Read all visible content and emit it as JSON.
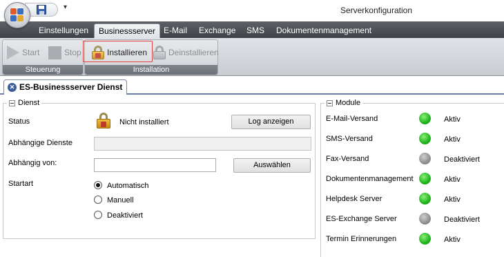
{
  "window": {
    "title": "Serverkonfiguration"
  },
  "ribbon": {
    "tabs": [
      "Einstellungen",
      "Businessserver",
      "E-Mail",
      "Exchange",
      "SMS",
      "Dokumentenmanagement"
    ],
    "active_tab": "Businessserver",
    "groups": [
      {
        "label": "Steuerung",
        "buttons": [
          {
            "label": "Start",
            "icon": "play-icon",
            "enabled": false
          },
          {
            "label": "Stop",
            "icon": "stop-icon",
            "enabled": false
          }
        ]
      },
      {
        "label": "Installation",
        "buttons": [
          {
            "label": "Installieren",
            "icon": "lock-icon",
            "enabled": true
          },
          {
            "label": "Deinstallieren",
            "icon": "lock-icon",
            "enabled": false
          }
        ]
      }
    ]
  },
  "doc_tab": {
    "label": "ES-Businessserver Dienst",
    "close_icon": "close-icon"
  },
  "dienst": {
    "legend": "Dienst",
    "status_label": "Status",
    "status_value": "Nicht installiert",
    "log_button": "Log anzeigen",
    "abhaengige_dienste_label": "Abhängige Dienste",
    "abhaengige_dienste_value": "",
    "abhaengig_von_label": "Abhängig von:",
    "abhaengig_von_value": "",
    "auswaehlen_button": "Auswählen",
    "startart_label": "Startart",
    "startart_options": [
      {
        "label": "Automatisch",
        "checked": true
      },
      {
        "label": "Manuell",
        "checked": false
      },
      {
        "label": "Deaktiviert",
        "checked": false
      }
    ]
  },
  "module": {
    "legend": "Module",
    "items": [
      {
        "name": "E-Mail-Versand",
        "state": "Aktiv",
        "color": "#22b81f"
      },
      {
        "name": "SMS-Versand",
        "state": "Aktiv",
        "color": "#22b81f"
      },
      {
        "name": "Fax-Versand",
        "state": "Deaktiviert",
        "color": "#8f8f8f"
      },
      {
        "name": "Dokumentenmanagement",
        "state": "Aktiv",
        "color": "#22b81f"
      },
      {
        "name": "Helpdesk Server",
        "state": "Aktiv",
        "color": "#22b81f"
      },
      {
        "name": "ES-Exchange Server",
        "state": "Deaktiviert",
        "color": "#8f8f8f"
      },
      {
        "name": "Termin Erinnerungen",
        "state": "Aktiv",
        "color": "#22b81f"
      }
    ]
  }
}
